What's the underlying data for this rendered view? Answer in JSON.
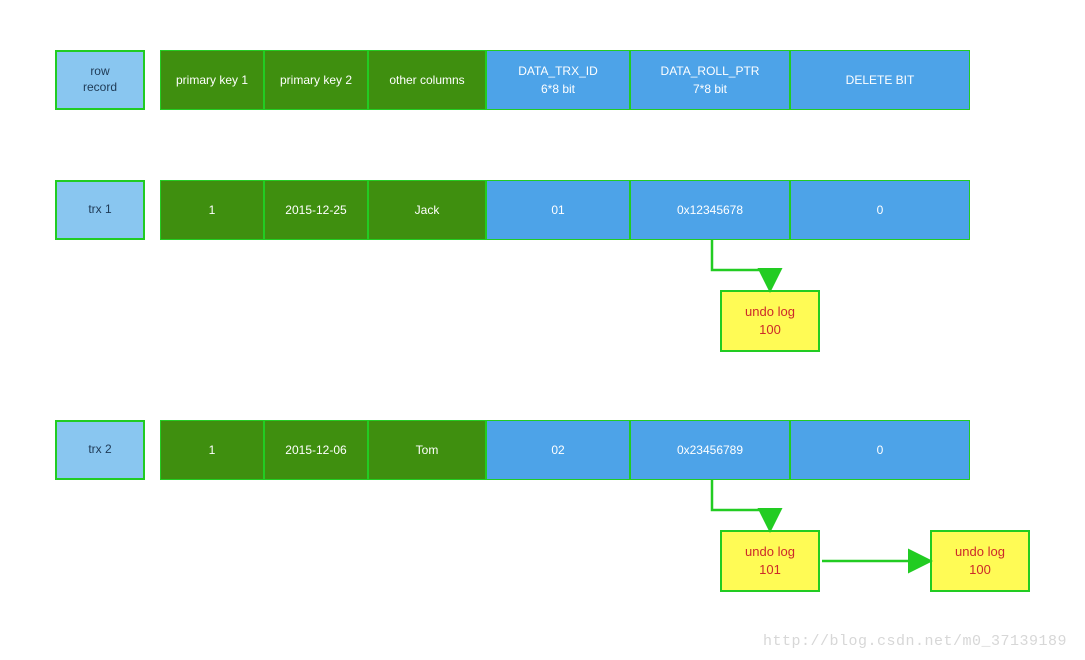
{
  "header": {
    "label": "row\nrecord",
    "cells": [
      {
        "text": "primary key 1",
        "cls": "green w-pk"
      },
      {
        "text": "primary key 2",
        "cls": "green w-pk"
      },
      {
        "text": "other columns",
        "cls": "green w-other"
      },
      {
        "text": "DATA_TRX_ID\n6*8 bit",
        "cls": "blue w-trx"
      },
      {
        "text": "DATA_ROLL_PTR\n7*8 bit",
        "cls": "blue w-roll"
      },
      {
        "text": "DELETE BIT",
        "cls": "blue w-del"
      }
    ]
  },
  "rows": [
    {
      "label": "trx 1",
      "cells": [
        {
          "text": "1",
          "cls": "green w-pk"
        },
        {
          "text": "2015-12-25",
          "cls": "green w-pk"
        },
        {
          "text": "Jack",
          "cls": "green w-other"
        },
        {
          "text": "01",
          "cls": "blue w-trx"
        },
        {
          "text": "0x12345678",
          "cls": "blue w-roll"
        },
        {
          "text": "0",
          "cls": "blue w-del"
        }
      ]
    },
    {
      "label": "trx 2",
      "cells": [
        {
          "text": "1",
          "cls": "green w-pk"
        },
        {
          "text": "2015-12-06",
          "cls": "green w-pk"
        },
        {
          "text": "Tom",
          "cls": "green w-other"
        },
        {
          "text": "02",
          "cls": "blue w-trx"
        },
        {
          "text": "0x23456789",
          "cls": "blue w-roll"
        },
        {
          "text": "0",
          "cls": "blue w-del"
        }
      ]
    }
  ],
  "undo_boxes": {
    "u1": "undo log\n100",
    "u2": "undo log\n101",
    "u3": "undo log\n100"
  },
  "watermark": "http://blog.csdn.net/m0_37139189"
}
